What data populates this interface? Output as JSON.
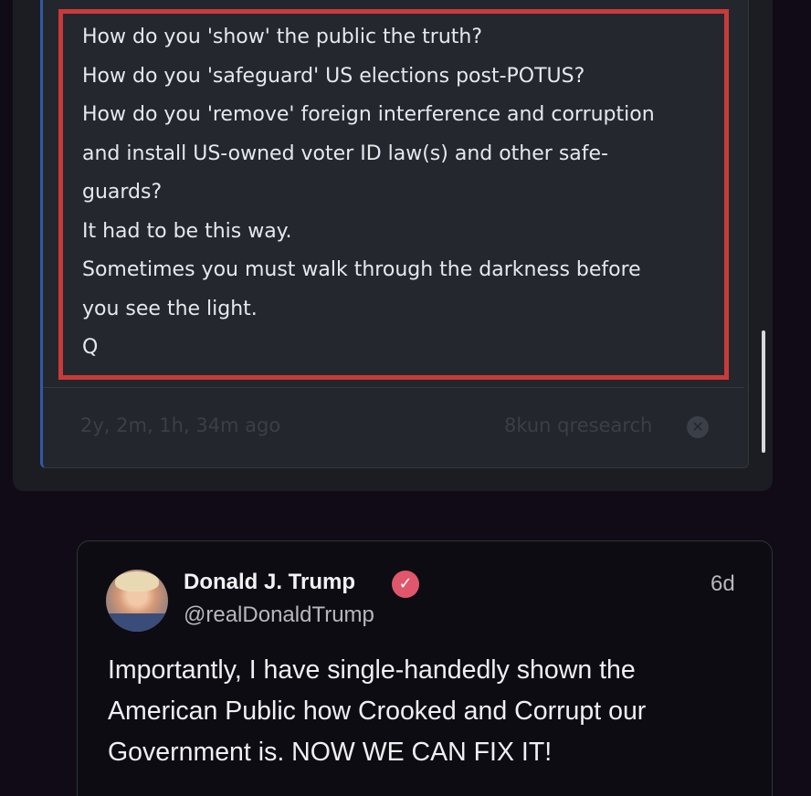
{
  "q_post": {
    "lines": [
      "How do you 'show' the public the truth?",
      "How do you 'safeguard' US elections post-POTUS?",
      "How do you 'remove' foreign interference and corruption",
      "and install US-owned voter ID law(s) and other safe-",
      "guards?",
      "It had to be this way.",
      "Sometimes you must walk through the darkness before",
      "you see the light.",
      "Q"
    ],
    "time_ago": "2y, 2m, 1h, 34m ago",
    "board": "8kun qresearch",
    "close_icon": "✕",
    "highlight_color": "#c93a3a"
  },
  "tweet": {
    "name": "Donald J. Trump",
    "handle": "@realDonaldTrump",
    "time": "6d",
    "verified_icon": "✓",
    "body_lines": [
      "Importantly, I have single-handedly shown the",
      "American Public how Crooked and Corrupt our",
      "Government is. NOW WE CAN FIX IT!"
    ]
  }
}
